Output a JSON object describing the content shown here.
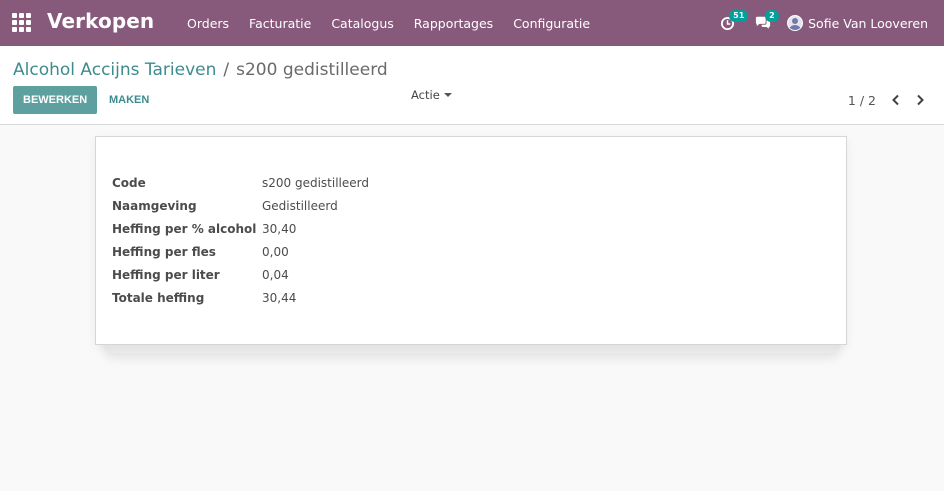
{
  "navbar": {
    "app_title": "Verkopen",
    "menu": [
      "Orders",
      "Facturatie",
      "Catalogus",
      "Rapportages",
      "Configuratie"
    ],
    "activity_badge": "51",
    "messages_badge": "2",
    "user_name": "Sofie Van Looveren"
  },
  "breadcrumb": {
    "parent": "Alcohol Accijns Tarieven",
    "separator": "/",
    "current": "s200 gedistilleerd"
  },
  "buttons": {
    "edit": "BEWERKEN",
    "create": "MAKEN",
    "action": "Actie"
  },
  "pager": {
    "value": "1 / 2"
  },
  "form": {
    "fields": [
      {
        "label": "Code",
        "value": "s200 gedistilleerd"
      },
      {
        "label": "Naamgeving",
        "value": "Gedistilleerd"
      },
      {
        "label": "Heffing per % alcohol",
        "value": "30,40"
      },
      {
        "label": "Heffing per fles",
        "value": "0,00"
      },
      {
        "label": "Heffing per liter",
        "value": "0,04"
      },
      {
        "label": "Totale heffing",
        "value": "30,44"
      }
    ]
  },
  "colors": {
    "navbar": "#875a7b",
    "primary_button": "#5da09f",
    "link": "#3c8b8f",
    "badge": "#00a09d"
  },
  "icons": {
    "apps": "apps-grid-icon",
    "activity": "clock-icon",
    "messages": "chat-bubbles-icon",
    "pager_prev": "chevron-left-icon",
    "pager_next": "chevron-right-icon",
    "action_caret": "caret-down-icon"
  }
}
